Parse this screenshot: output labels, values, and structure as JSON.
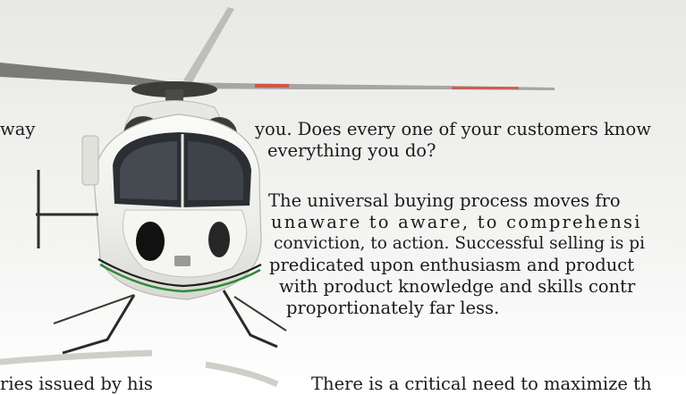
{
  "left_column": {
    "fragment_top": "way",
    "fragment_bottom": "ries issued by his"
  },
  "right_column": {
    "lines": [
      "you. Does every one of your customers know",
      "everything you do?",
      "The universal buying process moves fro",
      "unaware to aware, to comprehensi",
      "conviction, to action. Successful selling is pi",
      "predicated upon enthusiasm and product",
      "with product knowledge and skills contr",
      "proportionately far less.",
      "There is a critical need to maximize th"
    ]
  },
  "colors": {
    "text": "#1b1b1b",
    "background": "#ffffff",
    "helicopter_body": "#f2f2ef",
    "rotor_red": "#d8452f"
  },
  "icons": [
    "helicopter-photo"
  ]
}
